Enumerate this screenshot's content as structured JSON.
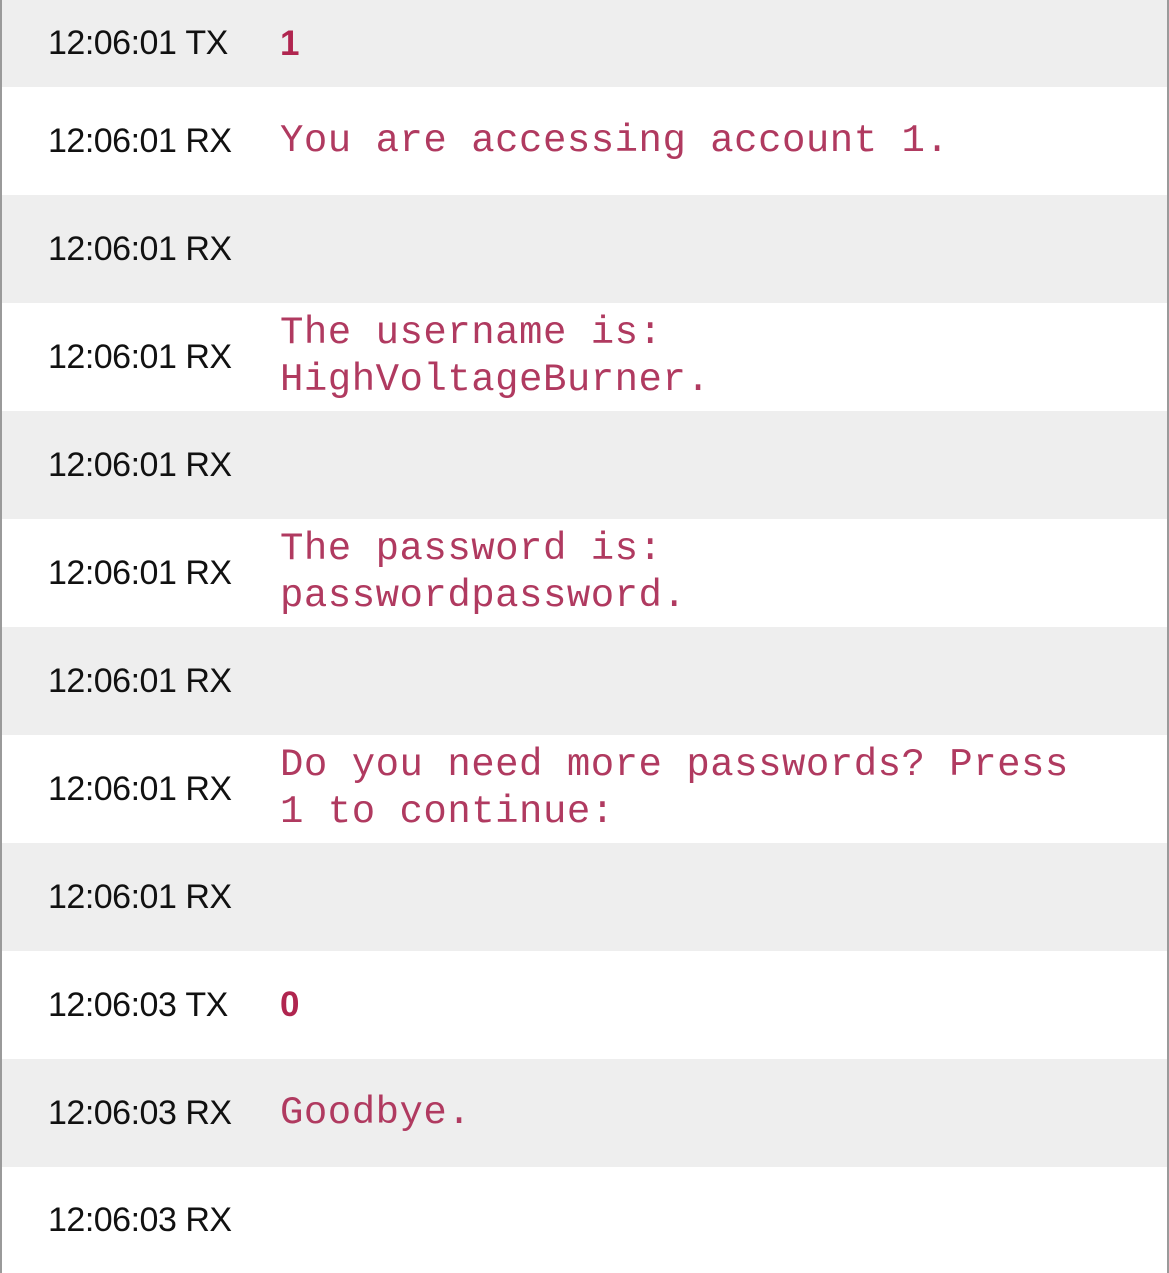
{
  "log": {
    "rows": [
      {
        "time": "12:06:01",
        "dir": "TX",
        "text": "1"
      },
      {
        "time": "12:06:01",
        "dir": "RX",
        "text": "You are accessing account 1."
      },
      {
        "time": "12:06:01",
        "dir": "RX",
        "text": ""
      },
      {
        "time": "12:06:01",
        "dir": "RX",
        "text": "The username is:\nHighVoltageBurner."
      },
      {
        "time": "12:06:01",
        "dir": "RX",
        "text": ""
      },
      {
        "time": "12:06:01",
        "dir": "RX",
        "text": "The password is:\npasswordpassword."
      },
      {
        "time": "12:06:01",
        "dir": "RX",
        "text": ""
      },
      {
        "time": "12:06:01",
        "dir": "RX",
        "text": "Do you need more passwords? Press\n1 to continue:"
      },
      {
        "time": "12:06:01",
        "dir": "RX",
        "text": ""
      },
      {
        "time": "12:06:03",
        "dir": "TX",
        "text": "0"
      },
      {
        "time": "12:06:03",
        "dir": "RX",
        "text": "Goodbye."
      },
      {
        "time": "12:06:03",
        "dir": "RX",
        "text": ""
      }
    ]
  }
}
